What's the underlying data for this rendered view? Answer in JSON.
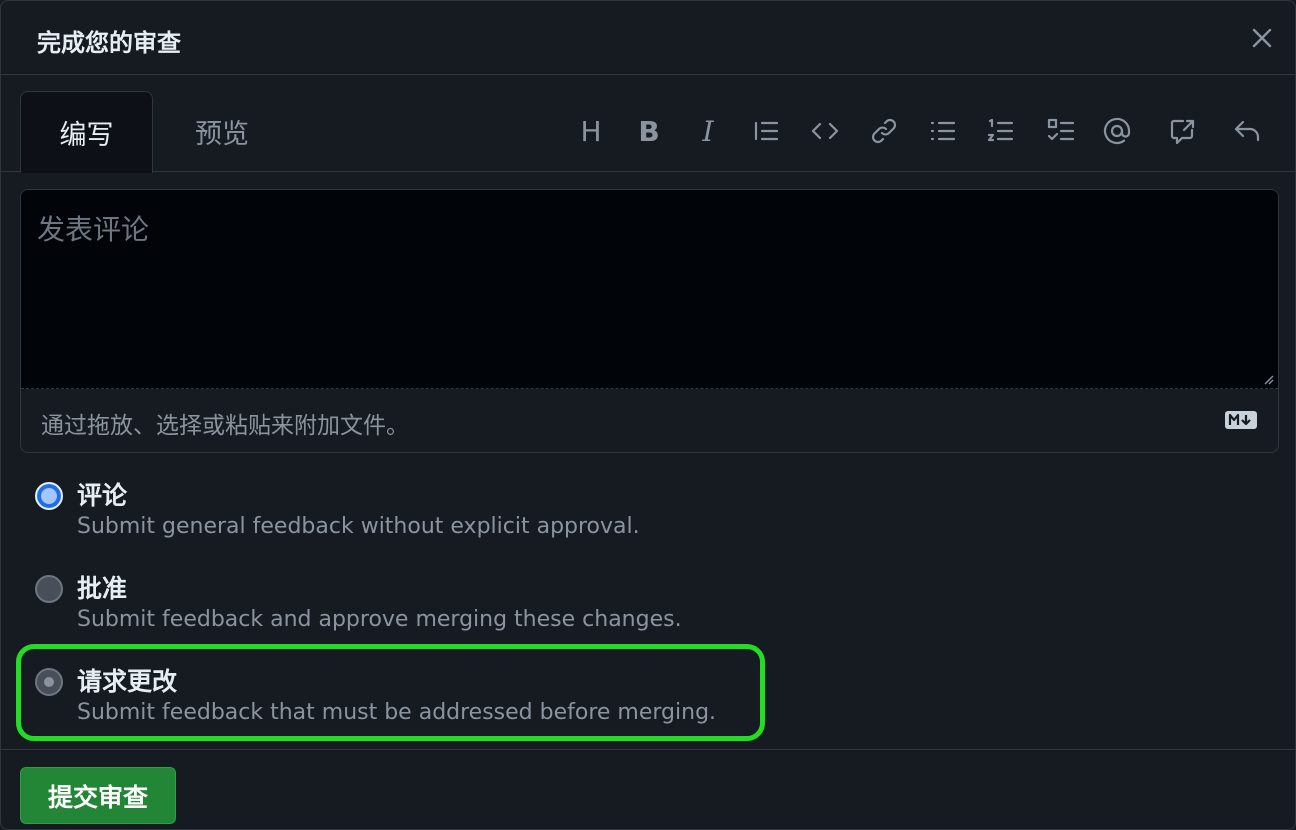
{
  "dialog": {
    "title": "完成您的审查"
  },
  "tabs": {
    "write": "编写",
    "preview": "预览"
  },
  "toolbar": {
    "heading_glyph": "H",
    "bold_glyph": "B",
    "italic_glyph": "I"
  },
  "editor": {
    "placeholder": "发表评论",
    "attach_hint": "通过拖放、选择或粘贴来附加文件。"
  },
  "options": [
    {
      "label": "评论",
      "description": "Submit general feedback without explicit approval.",
      "checked": true
    },
    {
      "label": "批准",
      "description": "Submit feedback and approve merging these changes.",
      "checked": false
    },
    {
      "label": "请求更改",
      "description": "Submit feedback that must be addressed before merging.",
      "checked": false
    }
  ],
  "submit": {
    "label": "提交审查"
  },
  "colors": {
    "background": "#161b22",
    "border": "#30363d",
    "primary_button": "#238636",
    "highlight": "#22dd22",
    "radio_checked": "#a5c6ff"
  }
}
